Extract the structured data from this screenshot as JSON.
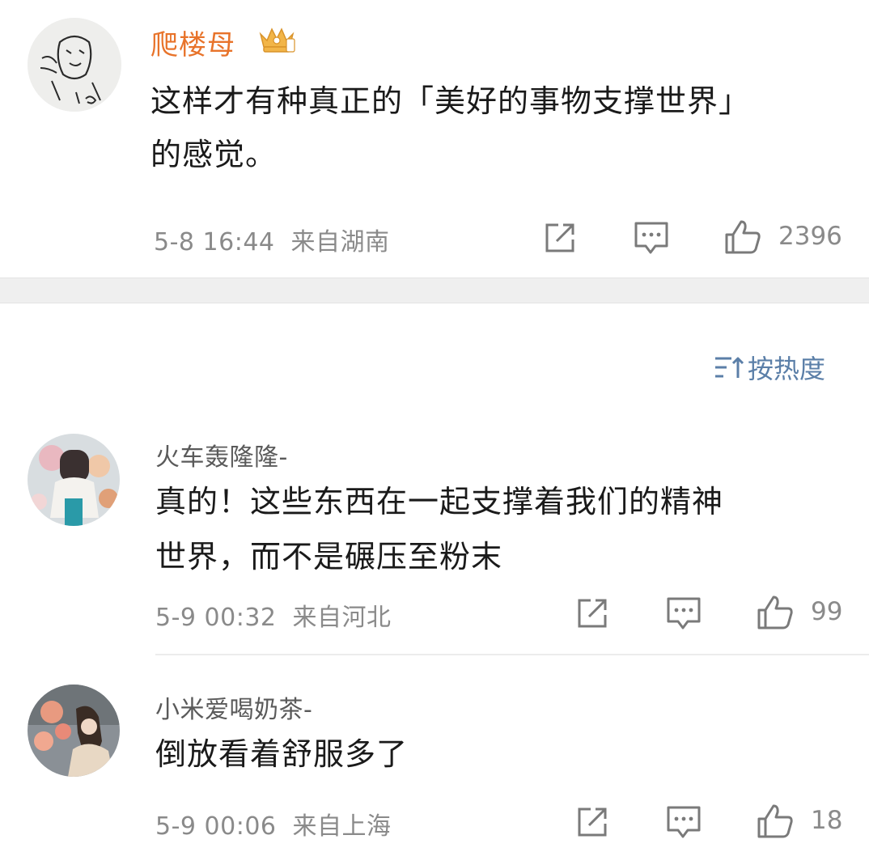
{
  "post": {
    "username": "爬楼母",
    "badge_icon": "crown-badge-icon",
    "text_line1": "这样才有种真正的「美好的事物支撑世界」",
    "text_line2": "的感觉。",
    "time": "5-8 16:44",
    "location": "来自湖南",
    "likes": "2396"
  },
  "sort": {
    "label": "按热度",
    "icon": "sort-icon"
  },
  "comments": [
    {
      "username": "火车轰隆隆-",
      "text_line1": "真的！这些东西在一起支撑着我们的精神",
      "text_line2": "世界，而不是碾压至粉末",
      "time": "5-9 00:32",
      "location": "来自河北",
      "likes": "99"
    },
    {
      "username": "小米爱喝奶茶-",
      "text_line1": "倒放看着舒服多了",
      "time": "5-9 00:06",
      "location": "来自上海",
      "likes": "18"
    }
  ],
  "colors": {
    "username_accent": "#e8732a",
    "sort_link": "#5b7fa8",
    "meta_gray": "#8a8a8a"
  }
}
